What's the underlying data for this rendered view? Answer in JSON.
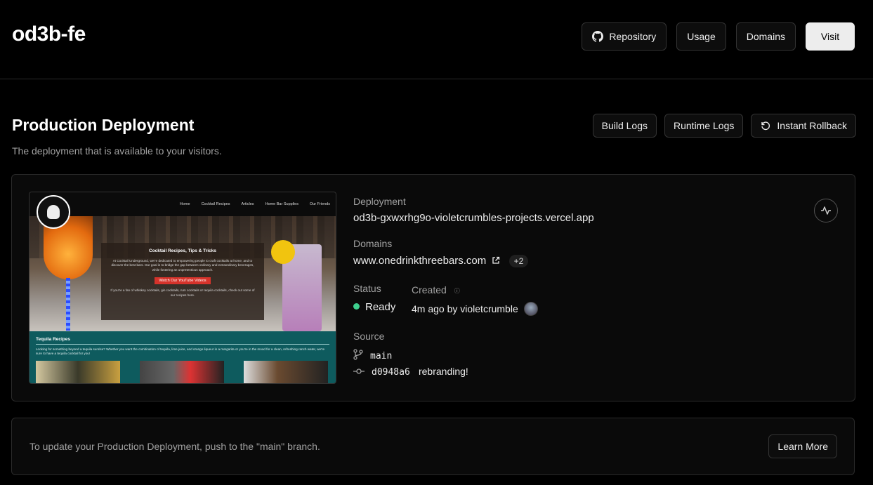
{
  "header": {
    "project_name": "od3b-fe",
    "buttons": {
      "repository": "Repository",
      "usage": "Usage",
      "domains": "Domains",
      "visit": "Visit"
    }
  },
  "production": {
    "title": "Production Deployment",
    "subtitle": "The deployment that is available to your visitors.",
    "actions": {
      "build_logs": "Build Logs",
      "runtime_logs": "Runtime Logs",
      "instant_rollback": "Instant Rollback"
    }
  },
  "preview": {
    "nav_links": [
      "Home",
      "Cocktail Recipes",
      "Articles",
      "Home Bar Supplies",
      "Our Friends"
    ],
    "hero_title": "Cocktail Recipes, Tips & Tricks",
    "hero_body": "At Cocktail Underground, we're dedicated to empowering people to craft cocktails at home, and to discover the best bars. Our goal is to bridge the gap between ordinary and extraordinary beverages, while fostering an unpretentious approach.",
    "cta": "Watch Our YouTube Videos",
    "hero_footer": "If you're a fan of whiskey cocktails, gin cocktails, rum cocktails or tequila cocktails, check out some of our recipes here.",
    "section_title": "Tequila Recipes",
    "section_body": "Looking for something beyond a tequila sunrise? Whether you want the combination of tequila, lime juice, and orange liqueur in a margarita or you're in the mood for a clean, refreshing ranch water, we're sure to have a tequila cocktail for you!"
  },
  "deployment": {
    "deployment_label": "Deployment",
    "deployment_url": "od3b-gxwxrhg9o-violetcrumbles-projects.vercel.app",
    "domains_label": "Domains",
    "domain": "www.onedrinkthreebars.com",
    "domain_extra": "+2",
    "status_label": "Status",
    "status_value": "Ready",
    "status_color": "#3ecf8e",
    "created_label": "Created",
    "created_value": "4m ago by violetcrumble",
    "source_label": "Source",
    "branch": "main",
    "commit_hash": "d0948a6",
    "commit_message": "rebranding!"
  },
  "footer": {
    "text": "To update your Production Deployment, push to the \"main\" branch.",
    "button": "Learn More"
  }
}
